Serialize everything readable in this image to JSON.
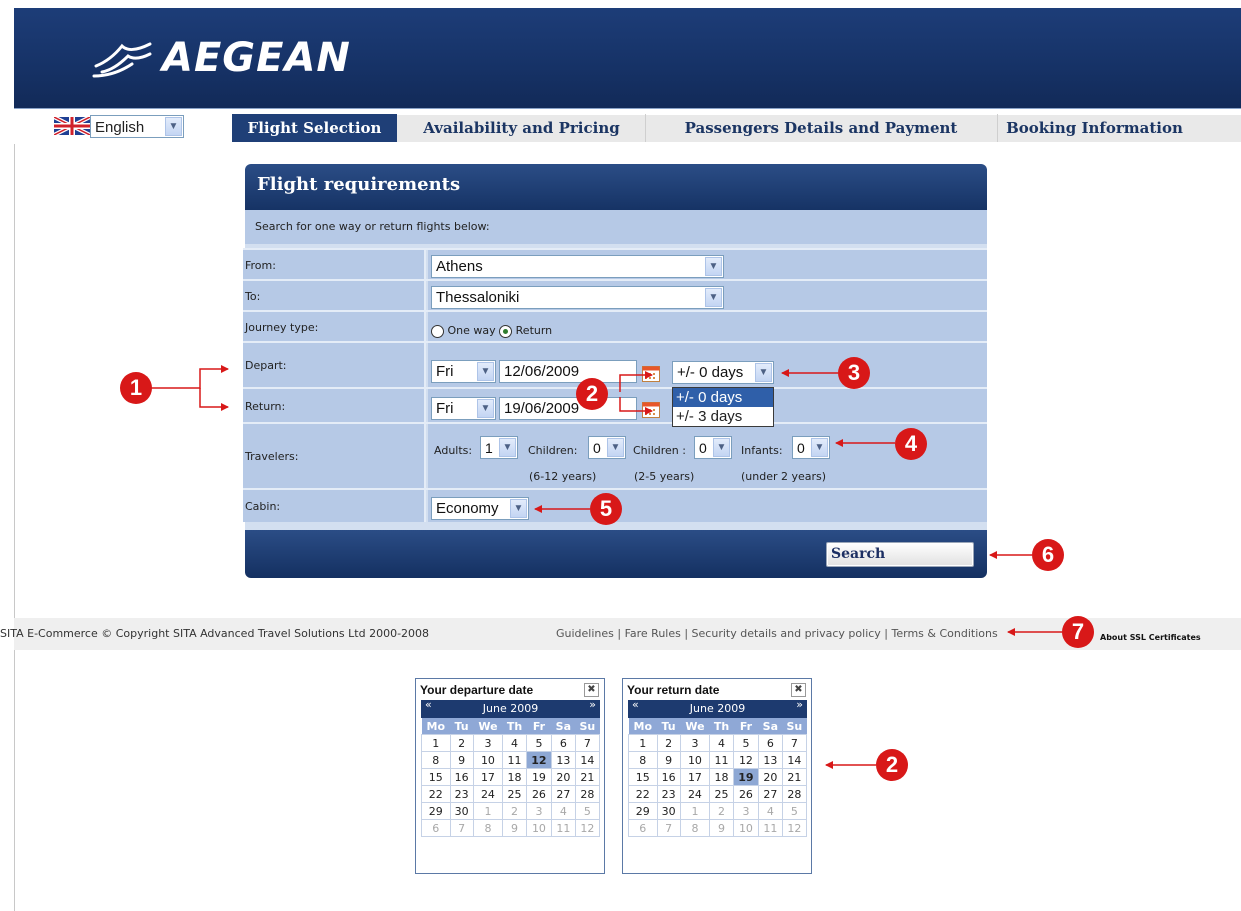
{
  "brand": {
    "name": "AEGEAN",
    "logo_icon": "aegean-bird-logo-icon"
  },
  "language": {
    "selected": "English",
    "flag_icon": "uk-flag-icon"
  },
  "tabs": [
    {
      "label": "Flight Selection",
      "active": true
    },
    {
      "label": "Availability and Pricing",
      "active": false
    },
    {
      "label": "Passengers Details and Payment",
      "active": false
    },
    {
      "label": "Booking Information",
      "active": false
    }
  ],
  "form": {
    "title": "Flight requirements",
    "subtitle": "Search for one way or return flights below:",
    "from": {
      "label": "From:",
      "value": "Athens"
    },
    "to": {
      "label": "To:",
      "value": "Thessaloniki"
    },
    "journey": {
      "label": "Journey type:",
      "option_one_way": "One way",
      "option_return": "Return",
      "selected": "Return"
    },
    "depart": {
      "label": "Depart:",
      "day": "Fri",
      "date": "12/06/2009",
      "flex": "+/- 0 days"
    },
    "return": {
      "label": "Return:",
      "day": "Fri",
      "date": "19/06/2009"
    },
    "flex_options": [
      "+/- 0 days",
      "+/- 3 days"
    ],
    "travelers": {
      "label": "Travelers:",
      "adults_label": "Adults:",
      "adults": "1",
      "children_label": "Children:",
      "children": "0",
      "children_note": "(6-12 years)",
      "children2_label": "Children :",
      "children2": "0",
      "children2_note": "(2-5 years)",
      "infants_label": "Infants:",
      "infants": "0",
      "infants_note": "(under 2 years)"
    },
    "cabin": {
      "label": "Cabin:",
      "value": "Economy"
    },
    "search_label": "Search"
  },
  "footer": {
    "copyright": "SITA E-Commerce © Copyright SITA Advanced Travel Solutions Ltd 2000-2008",
    "links": "Guidelines | Fare Rules | Security details and privacy policy | Terms & Conditions",
    "ssl": "About SSL Certificates"
  },
  "calendars": [
    {
      "title": "Your departure date",
      "month": "June 2009",
      "selected": "12"
    },
    {
      "title": "Your return date",
      "month": "June 2009",
      "selected": "19"
    }
  ],
  "calendar_weekdays": [
    "Mo",
    "Tu",
    "We",
    "Th",
    "Fr",
    "Sa",
    "Su"
  ],
  "calendar_weeks": [
    [
      "1",
      "2",
      "3",
      "4",
      "5",
      "6",
      "7"
    ],
    [
      "8",
      "9",
      "10",
      "11",
      "12",
      "13",
      "14"
    ],
    [
      "15",
      "16",
      "17",
      "18",
      "19",
      "20",
      "21"
    ],
    [
      "22",
      "23",
      "24",
      "25",
      "26",
      "27",
      "28"
    ],
    [
      "29",
      "30",
      "1",
      "2",
      "3",
      "4",
      "5"
    ],
    [
      "6",
      "7",
      "8",
      "9",
      "10",
      "11",
      "12"
    ]
  ],
  "callouts": {
    "c1": "1",
    "c2": "2",
    "c3": "3",
    "c4": "4",
    "c5": "5",
    "c6": "6",
    "c7": "7"
  },
  "colors": {
    "navy": "#163266",
    "callout_red": "#d81818",
    "panel_blue": "#b6c9e6"
  }
}
